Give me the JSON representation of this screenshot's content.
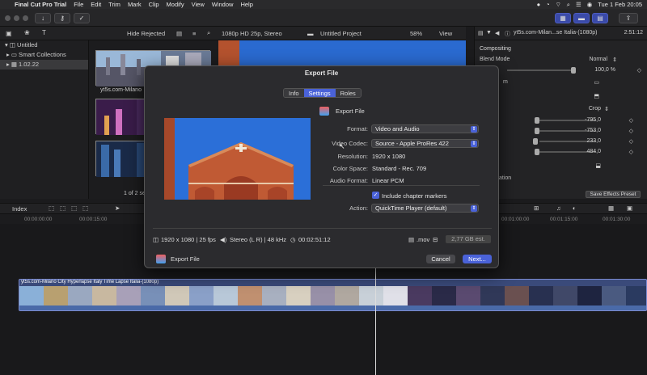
{
  "menubar": {
    "app": "Final Cut Pro Trial",
    "items": [
      "File",
      "Edit",
      "Trim",
      "Mark",
      "Clip",
      "Modify",
      "View",
      "Window",
      "Help"
    ],
    "clock": "Tue 1 Feb  20:05"
  },
  "browser_header": {
    "filter": "Hide Rejected",
    "format": "1080p HD 25p, Stereo",
    "project": "Untitled Project",
    "zoom": "58%",
    "view": "View"
  },
  "library": {
    "items": [
      {
        "label": "Untitled"
      },
      {
        "label": "Smart Collections"
      },
      {
        "label": "1.02.22"
      }
    ]
  },
  "browser": {
    "clip_name": "yt5s.com-Milano",
    "count": "1 of 2 se"
  },
  "inspector": {
    "header_title": "yt5s.com-Milan...se Italia-(1080p)",
    "header_time": "2:51:12",
    "section": "Compositing",
    "blend_mode_label": "Blend Mode",
    "blend_mode_value": "Normal",
    "opacity": "100,0 %",
    "crop_value": "Crop",
    "values": [
      "-795,0",
      "-753,0",
      "233,0",
      "484,0"
    ],
    "row_partial_1": "m",
    "row_partial_2": "ation",
    "save_button": "Save Effects Preset"
  },
  "timeline_header": {
    "index": "Index"
  },
  "ruler": {
    "ticks": [
      "00:00:00:00",
      "00:00:15:00",
      "00:01:00:00",
      "00:01:15:00",
      "00:01:30:00"
    ]
  },
  "timeline_clip": {
    "label": "yt5s.com-Milano City Hyperlapse Italy Time Lapse Italia-(1080p)"
  },
  "dialog": {
    "title": "Export File",
    "tabs": [
      {
        "label": "Info",
        "active": false
      },
      {
        "label": "Settings",
        "active": true
      },
      {
        "label": "Roles",
        "active": false
      }
    ],
    "dest_name": "Export File",
    "format_label": "Format:",
    "format_value": "Video and Audio",
    "codec_label": "Video Codec:",
    "codec_value": "Source - Apple ProRes 422",
    "resolution_label": "Resolution:",
    "resolution_value": "1920 x 1080",
    "colorspace_label": "Color Space:",
    "colorspace_value": "Standard - Rec. 709",
    "audio_label": "Audio Format:",
    "audio_value": "Linear PCM",
    "chapter_label": "Include chapter markers",
    "chapter_checked": true,
    "action_label": "Action:",
    "action_value": "QuickTime Player (default)",
    "footer_video": "1920 x 1080 | 25 fps",
    "footer_audio": "Stereo (L R) | 48 kHz",
    "footer_duration": "00:02:51:12",
    "footer_ext": ".mov",
    "footer_size": "2,77 GB est.",
    "bottom_label": "Export File",
    "cancel": "Cancel",
    "next": "Next..."
  },
  "colors": {
    "accent": "#4a62d8",
    "sky": "#2c6fd6",
    "brick": "#b4522e"
  }
}
